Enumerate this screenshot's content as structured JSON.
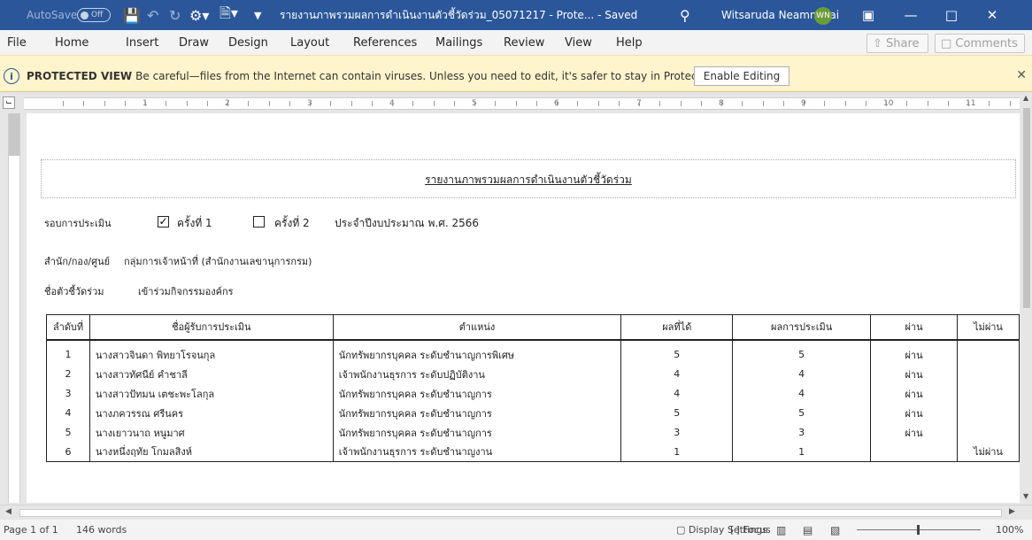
{
  "window": {
    "autosave_label": "AutoSave",
    "autosave_state": "Off",
    "doc_title": "รายงานภาพรวมผลการดำเนินงานตัวชี้วัดร่วม_05071217 - Prote... - Saved",
    "user_name": "Witsaruda Neammalai",
    "user_initials": "WN"
  },
  "menu": {
    "items": [
      "File",
      "Home",
      "Insert",
      "Draw",
      "Design",
      "Layout",
      "References",
      "Mailings",
      "Review",
      "View",
      "Help"
    ],
    "share_label": "Share",
    "comments_label": "Comments"
  },
  "protected_view": {
    "title": "PROTECTED VIEW",
    "message": "Be careful—files from the Internet can contain viruses. Unless you need to edit, it's safer to stay in Protected View.",
    "enable_label": "Enable Editing"
  },
  "ruler": {
    "numbers": [
      "1",
      "2",
      "3",
      "4",
      "5",
      "6",
      "7",
      "8",
      "9",
      "10",
      "11"
    ]
  },
  "document": {
    "heading": "รายงานภาพรวมผลการดำเนินงานตัวชี้วัดร่วม",
    "round_label": "รอบการประเมิน",
    "round1_label": "ครั้งที่ 1",
    "round1_checked": true,
    "round2_label": "ครั้งที่ 2",
    "round2_checked": false,
    "fiscal_year": "ประจำปีงบประมาณ พ.ศ. 2566",
    "office_label": "สำนัก/กอง/ศูนย์",
    "office_value": "กลุ่มการเจ้าหน้าที่ (สำนักงานเลขานุการกรม)",
    "indicator_label": "ชื่อตัวชี้วัดร่วม",
    "indicator_value": "เข้าร่วมกิจกรรมองค์กร",
    "table": {
      "headers": [
        "ลำดับที่",
        "ชื่อผู้รับการประเมิน",
        "ตำแหน่ง",
        "ผลที่ได้",
        "ผลการประเมิน",
        "ผ่าน",
        "ไม่ผ่าน"
      ],
      "rows": [
        [
          "1",
          "นางสาวจินดา พิทยาโรจนกุล",
          "นักทรัพยากรบุคคล ระดับชำนาญการพิเศษ",
          "5",
          "5",
          "ผ่าน",
          ""
        ],
        [
          "2",
          "นางสาวทัศนีย์ คำชาลี",
          "เจ้าพนักงานธุรการ ระดับปฏิบัติงาน",
          "4",
          "4",
          "ผ่าน",
          ""
        ],
        [
          "3",
          "นางสาวปัทมน เตชะพะโลกุล",
          "นักทรัพยากรบุคคล ระดับชำนาญการ",
          "4",
          "4",
          "ผ่าน",
          ""
        ],
        [
          "4",
          "นางภควรรณ ศรีนคร",
          "นักทรัพยากรบุคคล ระดับชำนาญการ",
          "5",
          "5",
          "ผ่าน",
          ""
        ],
        [
          "5",
          "นางเยาวนาถ หนูมาศ",
          "นักทรัพยากรบุคคล ระดับชำนาญการ",
          "3",
          "3",
          "ผ่าน",
          ""
        ],
        [
          "6",
          "นางหนึ่งฤทัย โกมลสิงห์",
          "เจ้าพนักงานธุรการ ระดับชำนาญงาน",
          "1",
          "1",
          "",
          "ไม่ผ่าน"
        ]
      ]
    }
  },
  "status": {
    "page": "Page 1 of 1",
    "words": "146 words",
    "display_settings": "Display Settings",
    "focus": "Focus",
    "zoom": "100%"
  },
  "colors": {
    "titlebar": "#2b579a",
    "protected_bg": "#fff4cc"
  }
}
